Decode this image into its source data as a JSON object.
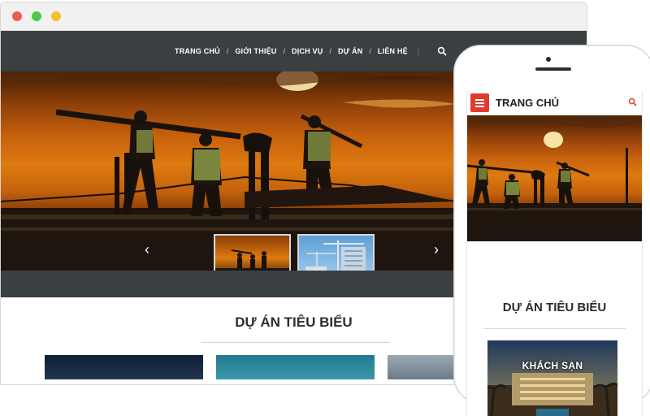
{
  "desktop": {
    "nav": {
      "items": [
        "TRANG CHỦ",
        "GIỚI THIỆU",
        "DỊCH VỤ",
        "DỰ ÁN",
        "LIÊN HỆ"
      ],
      "separator": "/",
      "search_icon": "search-icon"
    },
    "slider": {
      "prev_icon": "chevron-left-icon",
      "next_icon": "chevron-right-icon",
      "arrow_prev": "‹",
      "arrow_next": "›"
    },
    "section_title": "DỰ ÁN TIÊU BIỂU"
  },
  "mobile": {
    "header_title": "TRANG CHỦ",
    "menu_icon": "hamburger-icon",
    "search_icon": "search-icon",
    "section_title": "DỰ ÁN TIÊU BIỂU",
    "card_label": "KHÁCH SẠN"
  },
  "colors": {
    "nav_bg": "#3a3f42",
    "accent_red": "#e13b2f",
    "sunset_orange": "#dd7a10"
  }
}
